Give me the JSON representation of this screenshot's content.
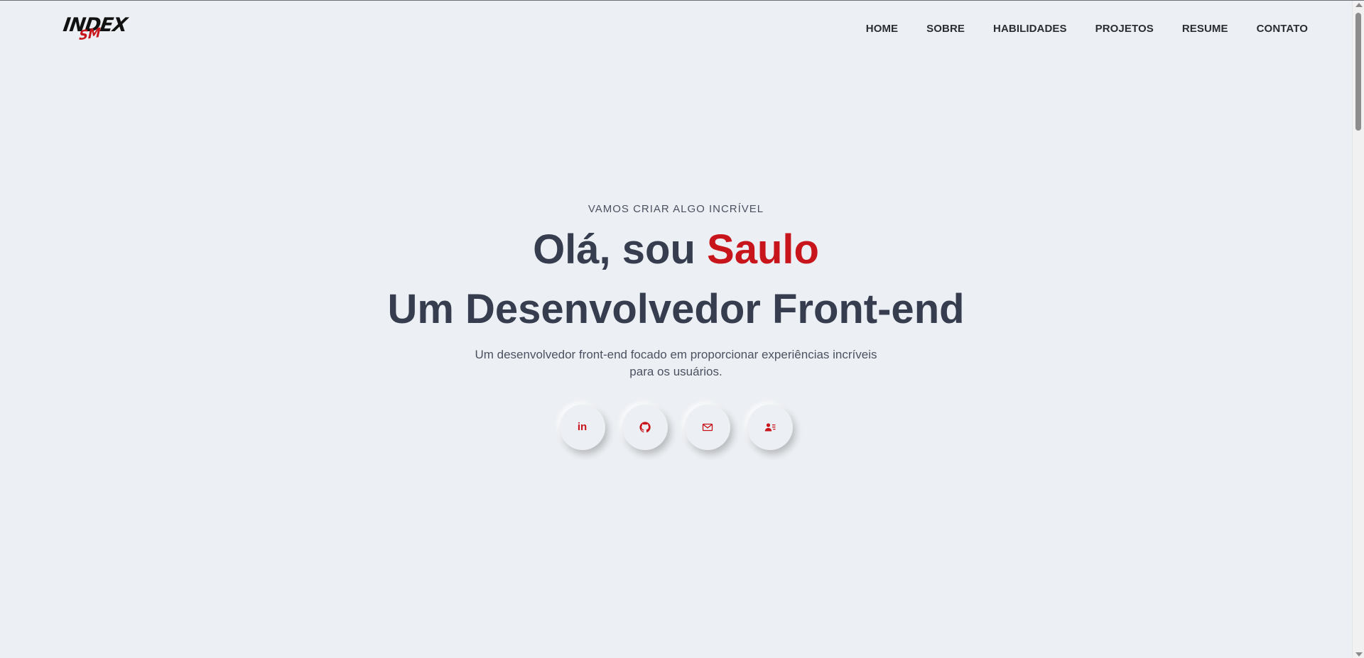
{
  "header": {
    "logo_main": "INDEX",
    "logo_sub": "SM",
    "nav": [
      {
        "label": "HOME"
      },
      {
        "label": "SOBRE"
      },
      {
        "label": "HABILIDADES"
      },
      {
        "label": "PROJETOS"
      },
      {
        "label": "RESUME"
      },
      {
        "label": "CONTATO"
      }
    ]
  },
  "hero": {
    "kicker": "VAMOS CRIAR ALGO INCRÍVEL",
    "greeting": "Olá, sou ",
    "name": "Saulo",
    "role": "Um Desenvolvedor Front-end",
    "description": "Um desenvolvedor front-end focado em proporcionar experiências incríveis para os usuários.",
    "socials": [
      {
        "icon": "linkedin-icon",
        "glyph": "in"
      },
      {
        "icon": "github-icon"
      },
      {
        "icon": "mail-icon"
      },
      {
        "icon": "contact-card-icon"
      }
    ]
  },
  "colors": {
    "background": "#eceff3",
    "accent": "#c8141b",
    "heading": "#363d4f",
    "text": "#4b5160"
  }
}
